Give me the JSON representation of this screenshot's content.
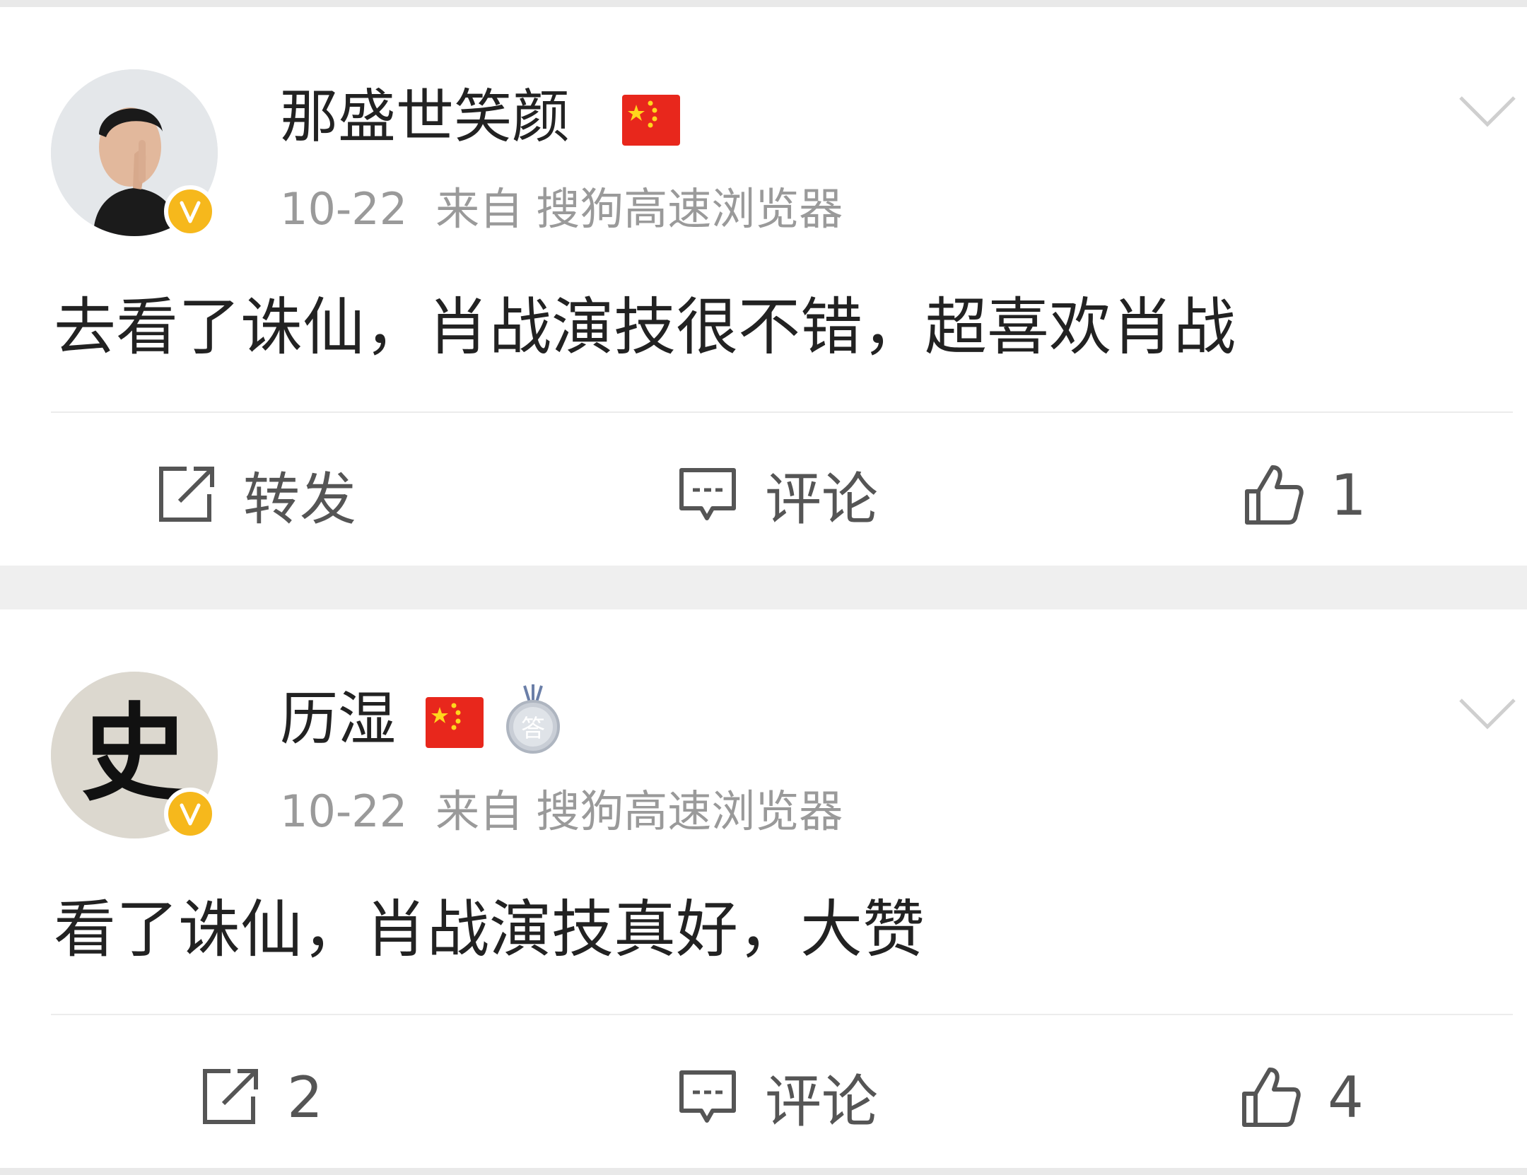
{
  "posts": [
    {
      "username": "那盛世笑颜",
      "date": "10-22",
      "source_prefix": "来自",
      "source_name": "搜狗高速浏览器",
      "content": "去看了诛仙，肖战演技很不错，超喜欢肖战",
      "avatar_icon": "man-photo-avatar",
      "badges": [
        "china-flag-icon",
        "verified-v-icon"
      ],
      "actions": {
        "repost": "转发",
        "comment": "评论",
        "like": "1"
      }
    },
    {
      "username": "历湿",
      "date": "10-22",
      "source_prefix": "来自",
      "source_name": "搜狗高速浏览器",
      "content": "看了诛仙，肖战演技真好，大赞",
      "avatar_icon": "calligraphy-avatar",
      "avatar_glyph": "史",
      "medal_glyph": "答",
      "badges": [
        "china-flag-icon",
        "answer-medal-icon",
        "verified-v-icon"
      ],
      "actions": {
        "repost": "2",
        "comment": "评论",
        "like": "4"
      }
    }
  ],
  "colors": {
    "text": "#222222",
    "meta": "#9a9a9a",
    "action": "#555555",
    "badge": "#f6b81c",
    "flag": "#e8271c",
    "separator": "#efefef"
  }
}
